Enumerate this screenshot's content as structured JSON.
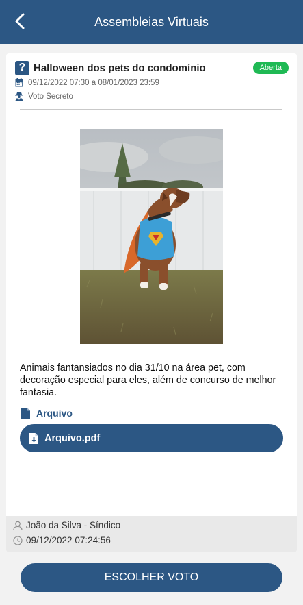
{
  "header": {
    "title": "Assembleias Virtuais",
    "back_icon": "chevron-left-icon"
  },
  "assembly": {
    "icon": "?",
    "title": "Halloween dos pets do condomínio",
    "status": "Aberta",
    "status_color": "#1fb954",
    "period": "09/12/2022 07:30 a 08/01/2023 23:59",
    "vote_type": "Voto Secreto",
    "image_alt": "Cachorro boxer fantasiado de Superman",
    "description": "Animais fantansiados no dia 31/10 na área pet, com decoração especial para eles, além de concurso de melhor fantasia.",
    "file_section_label": "Arquivo",
    "file_name": "Arquivo.pdf"
  },
  "author": {
    "name": "João da Silva - Síndico",
    "datetime": "09/12/2022 07:24:56"
  },
  "actions": {
    "vote_label": "ESCOLHER VOTO"
  },
  "colors": {
    "primary": "#2c5784",
    "badge": "#1fb954",
    "background": "#f2f2f2"
  }
}
